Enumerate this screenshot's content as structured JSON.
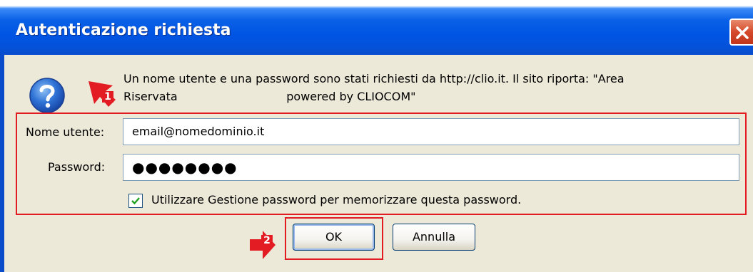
{
  "dialog": {
    "title": "Autenticazione richiesta",
    "message_line1": "Un nome utente e una password sono stati richiesti da http://clio.it. Il sito riporta: \"Area",
    "message_line2": "Riservata                              powered by CLIOCOM\"",
    "username_label": "Nome utente:",
    "username_value": "email@nomedominio.it",
    "password_label": "Password:",
    "password_value": "●●●●●●●●",
    "remember_label": "Utilizzare Gestione password per memorizzare questa password.",
    "remember_checked": true,
    "ok_label": "OK",
    "cancel_label": "Annulla"
  },
  "annotations": {
    "step1": "1",
    "step2": "2"
  },
  "colors": {
    "titlebar": "#0054e3",
    "dialog_bg": "#ece9d8",
    "highlight_red": "#e31b22",
    "close_red": "#d5492b"
  },
  "icons": [
    "help-question-icon",
    "close-x-icon",
    "checkmark-icon",
    "red-arrow-badge-icon"
  ]
}
